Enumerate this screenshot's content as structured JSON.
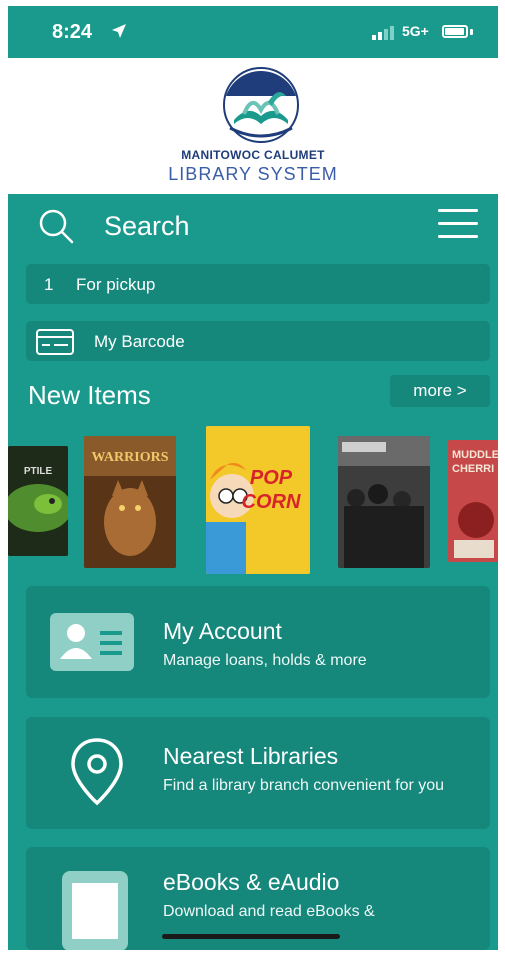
{
  "status_bar": {
    "time": "8:24",
    "network": "5G+"
  },
  "logo": {
    "line1": "MANITOWOC CALUMET",
    "line2": "LIBRARY SYSTEM"
  },
  "search": {
    "label": "Search"
  },
  "pickup": {
    "count": "1",
    "label": "For pickup"
  },
  "barcode": {
    "label": "My Barcode"
  },
  "new_items": {
    "title": "New Items",
    "more_label": "more >",
    "covers": [
      {
        "text": "PTILE"
      },
      {
        "text": "WARRIORS"
      },
      {
        "text": "POP CORN"
      },
      {
        "text": ""
      },
      {
        "text": "MUDDLE CHERRI"
      }
    ]
  },
  "cards": {
    "account": {
      "title": "My Account",
      "subtitle": "Manage loans, holds & more"
    },
    "nearest": {
      "title": "Nearest Libraries",
      "subtitle": "Find a library branch convenient for you"
    },
    "ebooks": {
      "title": "eBooks & eAudio",
      "subtitle": "Download and read eBooks &"
    }
  },
  "colors": {
    "teal": "#1a9a8c",
    "teal_dark": "#15877b",
    "logo_blue": "#1f3d7a"
  }
}
